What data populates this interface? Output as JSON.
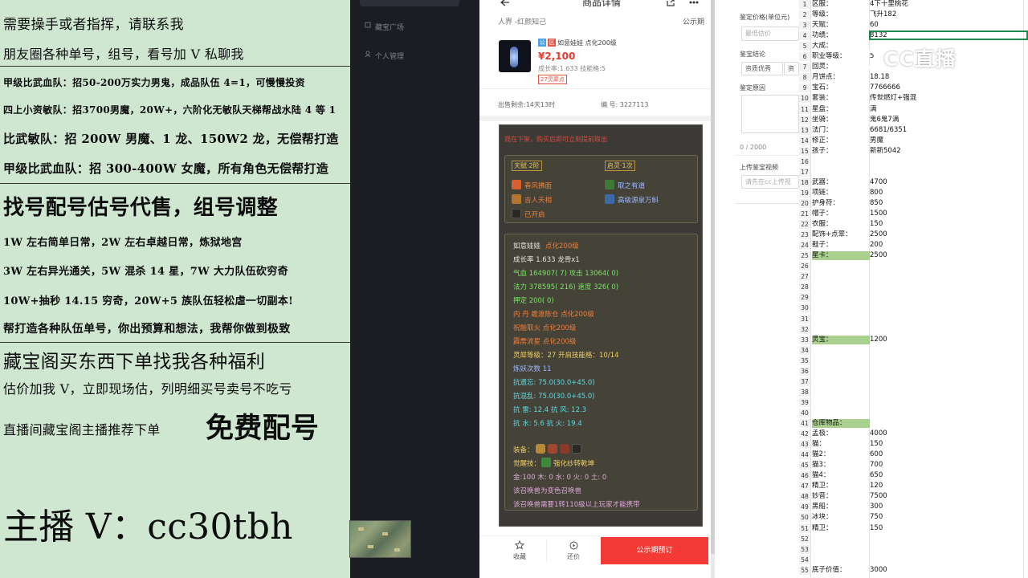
{
  "ad_panel": {
    "lines": [
      "需要操手或者指挥，请联系我",
      "朋友圈各种单号，组号，看号加 V 私聊我",
      "甲级比武血队：招50-200万实力男鬼，成品队伍 4=1，可慢慢投资",
      "四上小资敏队：招3700男魔，20W+，六阶化无敏队天梯帮战水陆 4 等 1",
      "比武敏队：招 200W 男魔、1 龙、150W2 龙，无偿帮打造",
      "甲级比武血队：招 300-400W 女魔，所有角色无偿帮打造",
      "找号配号估号代售，组号调整",
      "1W 左右简单日常，2W 左右卓越日常，炼狱地宫",
      "3W 左右异光通关，5W 混杀 14 星，7W 大力队伍砍穷奇",
      "10W+抽秒 14.15 穷奇，20W+5 族队伍轻松虐一切副本!",
      "帮打造各种队伍单号，你出预算和想法，我帮你做到极致",
      "藏宝阁买东西下单找我各种福利",
      "估价加我 V，立即现场估，列明细买号卖号不吃亏",
      "直播间藏宝阁主播推荐下单",
      "免费配号",
      "主播 V：cc30tbh"
    ]
  },
  "nav": {
    "items": [
      "藏宝广场",
      "个人管理"
    ]
  },
  "phone": {
    "title": "商品详情",
    "crumb_left": "人界 -红颜知己",
    "crumb_right": "公示期",
    "item_name": "如意娃娃 点化200级",
    "price": "¥2,100",
    "growth_line": "成长率:1.633 技能格:5",
    "badge": "27灵犀点",
    "sale_left": "出售剩余:14天13时",
    "serial": "编 号: 3227113",
    "card": {
      "warning": "观在下架，购买后即可立刻提前取出",
      "talent_label": "天赋·2阶",
      "spirit_label": "启灵·1次",
      "skills": [
        "春风拂面",
        "吉人天相",
        "已开启"
      ],
      "spirit_skills": [
        "取之有道",
        "高级源泉万斛"
      ],
      "name_line_a": "如意娃娃",
      "name_line_b": "点化200级",
      "stats": [
        {
          "text": "成长率 1.633 龙骨x1",
          "cls": "white"
        },
        {
          "text": "气血 164907( 7) 攻击 13064( 0)",
          "cls": "green"
        },
        {
          "text": "法力 378595( 216) 速度 326( 0)",
          "cls": "green"
        },
        {
          "text": "押定 200( 0)",
          "cls": "green"
        },
        {
          "text": "内   丹 蟾渡陈仓 点化200级",
          "cls": "orange"
        },
        {
          "text": "         祝融取火 点化200级",
          "cls": "orange"
        },
        {
          "text": "         霹雳流星 点化200级",
          "cls": "orange"
        },
        {
          "text": "灵犀等级：27 开启技能格：10/14",
          "cls": "gold"
        },
        {
          "text": "炼妖次数 11",
          "cls": "blue"
        },
        {
          "text": "抗遗忘: 75.0(30.0+45.0)",
          "cls": "cyan"
        },
        {
          "text": "抗混乱: 75.0(30.0+45.0)",
          "cls": "cyan"
        },
        {
          "text": "抗   雷: 12.4 抗   风: 12.3",
          "cls": "cyan"
        },
        {
          "text": "抗   水: 5.6 抗   火: 19.4",
          "cls": "cyan"
        }
      ],
      "equip_label": "装备：",
      "awaken_label": "觉醒技：",
      "awaken_skill": "强化纱转乾坤",
      "elements": "金:100 木: 0 水: 0 火: 0 土: 0",
      "note1": "该召唤兽为变色召唤兽",
      "note2": "该召唤兽需要1转110级以上玩家才能携带"
    },
    "bottom": {
      "fav": "收藏",
      "bargain": "还价",
      "order": "公示期预订"
    }
  },
  "form": {
    "price_label": "鉴定价格(单位元)",
    "price_placeholder": "最低估价",
    "conclusion_label": "鉴宝结论",
    "tab_a": "资质优秀",
    "tab_b": "资",
    "reason_label": "鉴定原因",
    "counter": "0 / 2000",
    "upload_label": "上传鉴宝视频",
    "upload_placeholder": "请先在cc上传视"
  },
  "sheet": {
    "rows": [
      {
        "n": "1",
        "a": "区服：",
        "b": "4下十里桃花"
      },
      {
        "n": "2",
        "a": "等级：",
        "b": "飞升182"
      },
      {
        "n": "3",
        "a": "天赋：",
        "b": "60"
      },
      {
        "n": "4",
        "a": "功绩：",
        "b": "8132"
      },
      {
        "n": "5",
        "a": "大成：",
        "b": ""
      },
      {
        "n": "6",
        "a": "职业等级：",
        "b": "5"
      },
      {
        "n": "7",
        "a": "回灵：",
        "b": ""
      },
      {
        "n": "8",
        "a": "月饼点：",
        "b": "18.18"
      },
      {
        "n": "9",
        "a": "宝石：",
        "b": "7766666"
      },
      {
        "n": "10",
        "a": "套装：",
        "b": "传世燃灯+强混"
      },
      {
        "n": "11",
        "a": "星盘：",
        "b": "满"
      },
      {
        "n": "12",
        "a": "坐骑：",
        "b": "鬼6鬼7满"
      },
      {
        "n": "13",
        "a": "法门：",
        "b": "6681/6351"
      },
      {
        "n": "14",
        "a": "修正：",
        "b": "男魔"
      },
      {
        "n": "15",
        "a": "孩子：",
        "b": "新新5042"
      },
      {
        "n": "16",
        "a": "",
        "b": ""
      },
      {
        "n": "17",
        "a": "",
        "b": ""
      },
      {
        "n": "18",
        "a": "武器：",
        "b": "4700"
      },
      {
        "n": "19",
        "a": "项链：",
        "b": "800"
      },
      {
        "n": "20",
        "a": "护身符：",
        "b": "850"
      },
      {
        "n": "21",
        "a": "帽子：",
        "b": "1500"
      },
      {
        "n": "22",
        "a": "衣服：",
        "b": "150"
      },
      {
        "n": "23",
        "a": "配饰+点翠：",
        "b": "2500"
      },
      {
        "n": "24",
        "a": "鞋子：",
        "b": "200"
      },
      {
        "n": "25",
        "a": "星卡：",
        "b": "2500"
      },
      {
        "n": "26",
        "a": "",
        "b": ""
      },
      {
        "n": "27",
        "a": "",
        "b": ""
      },
      {
        "n": "28",
        "a": "",
        "b": ""
      },
      {
        "n": "29",
        "a": "",
        "b": ""
      },
      {
        "n": "30",
        "a": "",
        "b": ""
      },
      {
        "n": "31",
        "a": "",
        "b": ""
      },
      {
        "n": "32",
        "a": "",
        "b": ""
      },
      {
        "n": "33",
        "a": "灵宝：",
        "b": "1200"
      },
      {
        "n": "34",
        "a": "",
        "b": ""
      },
      {
        "n": "35",
        "a": "",
        "b": ""
      },
      {
        "n": "36",
        "a": "",
        "b": ""
      },
      {
        "n": "37",
        "a": "",
        "b": ""
      },
      {
        "n": "38",
        "a": "",
        "b": ""
      },
      {
        "n": "39",
        "a": "",
        "b": ""
      },
      {
        "n": "40",
        "a": "",
        "b": ""
      },
      {
        "n": "41",
        "a": "仓库物品：",
        "b": ""
      },
      {
        "n": "42",
        "a": "孟极：",
        "b": "4000"
      },
      {
        "n": "43",
        "a": "猫：",
        "b": "150"
      },
      {
        "n": "44",
        "a": "猫2：",
        "b": "600"
      },
      {
        "n": "45",
        "a": "猫3：",
        "b": "700"
      },
      {
        "n": "46",
        "a": "猫4：",
        "b": "650"
      },
      {
        "n": "47",
        "a": "精卫：",
        "b": "120"
      },
      {
        "n": "48",
        "a": "妙音：",
        "b": "7500"
      },
      {
        "n": "49",
        "a": "黑船：",
        "b": "300"
      },
      {
        "n": "50",
        "a": "冰块：",
        "b": "750"
      },
      {
        "n": "51",
        "a": "精卫：",
        "b": "150"
      },
      {
        "n": "52",
        "a": "",
        "b": ""
      },
      {
        "n": "53",
        "a": "",
        "b": ""
      },
      {
        "n": "54",
        "a": "",
        "b": ""
      },
      {
        "n": "55",
        "a": "底子价值：",
        "b": "3000"
      }
    ],
    "highlight_color": "#a9d08e"
  },
  "overlay": {
    "logo_text": "CC直播"
  }
}
